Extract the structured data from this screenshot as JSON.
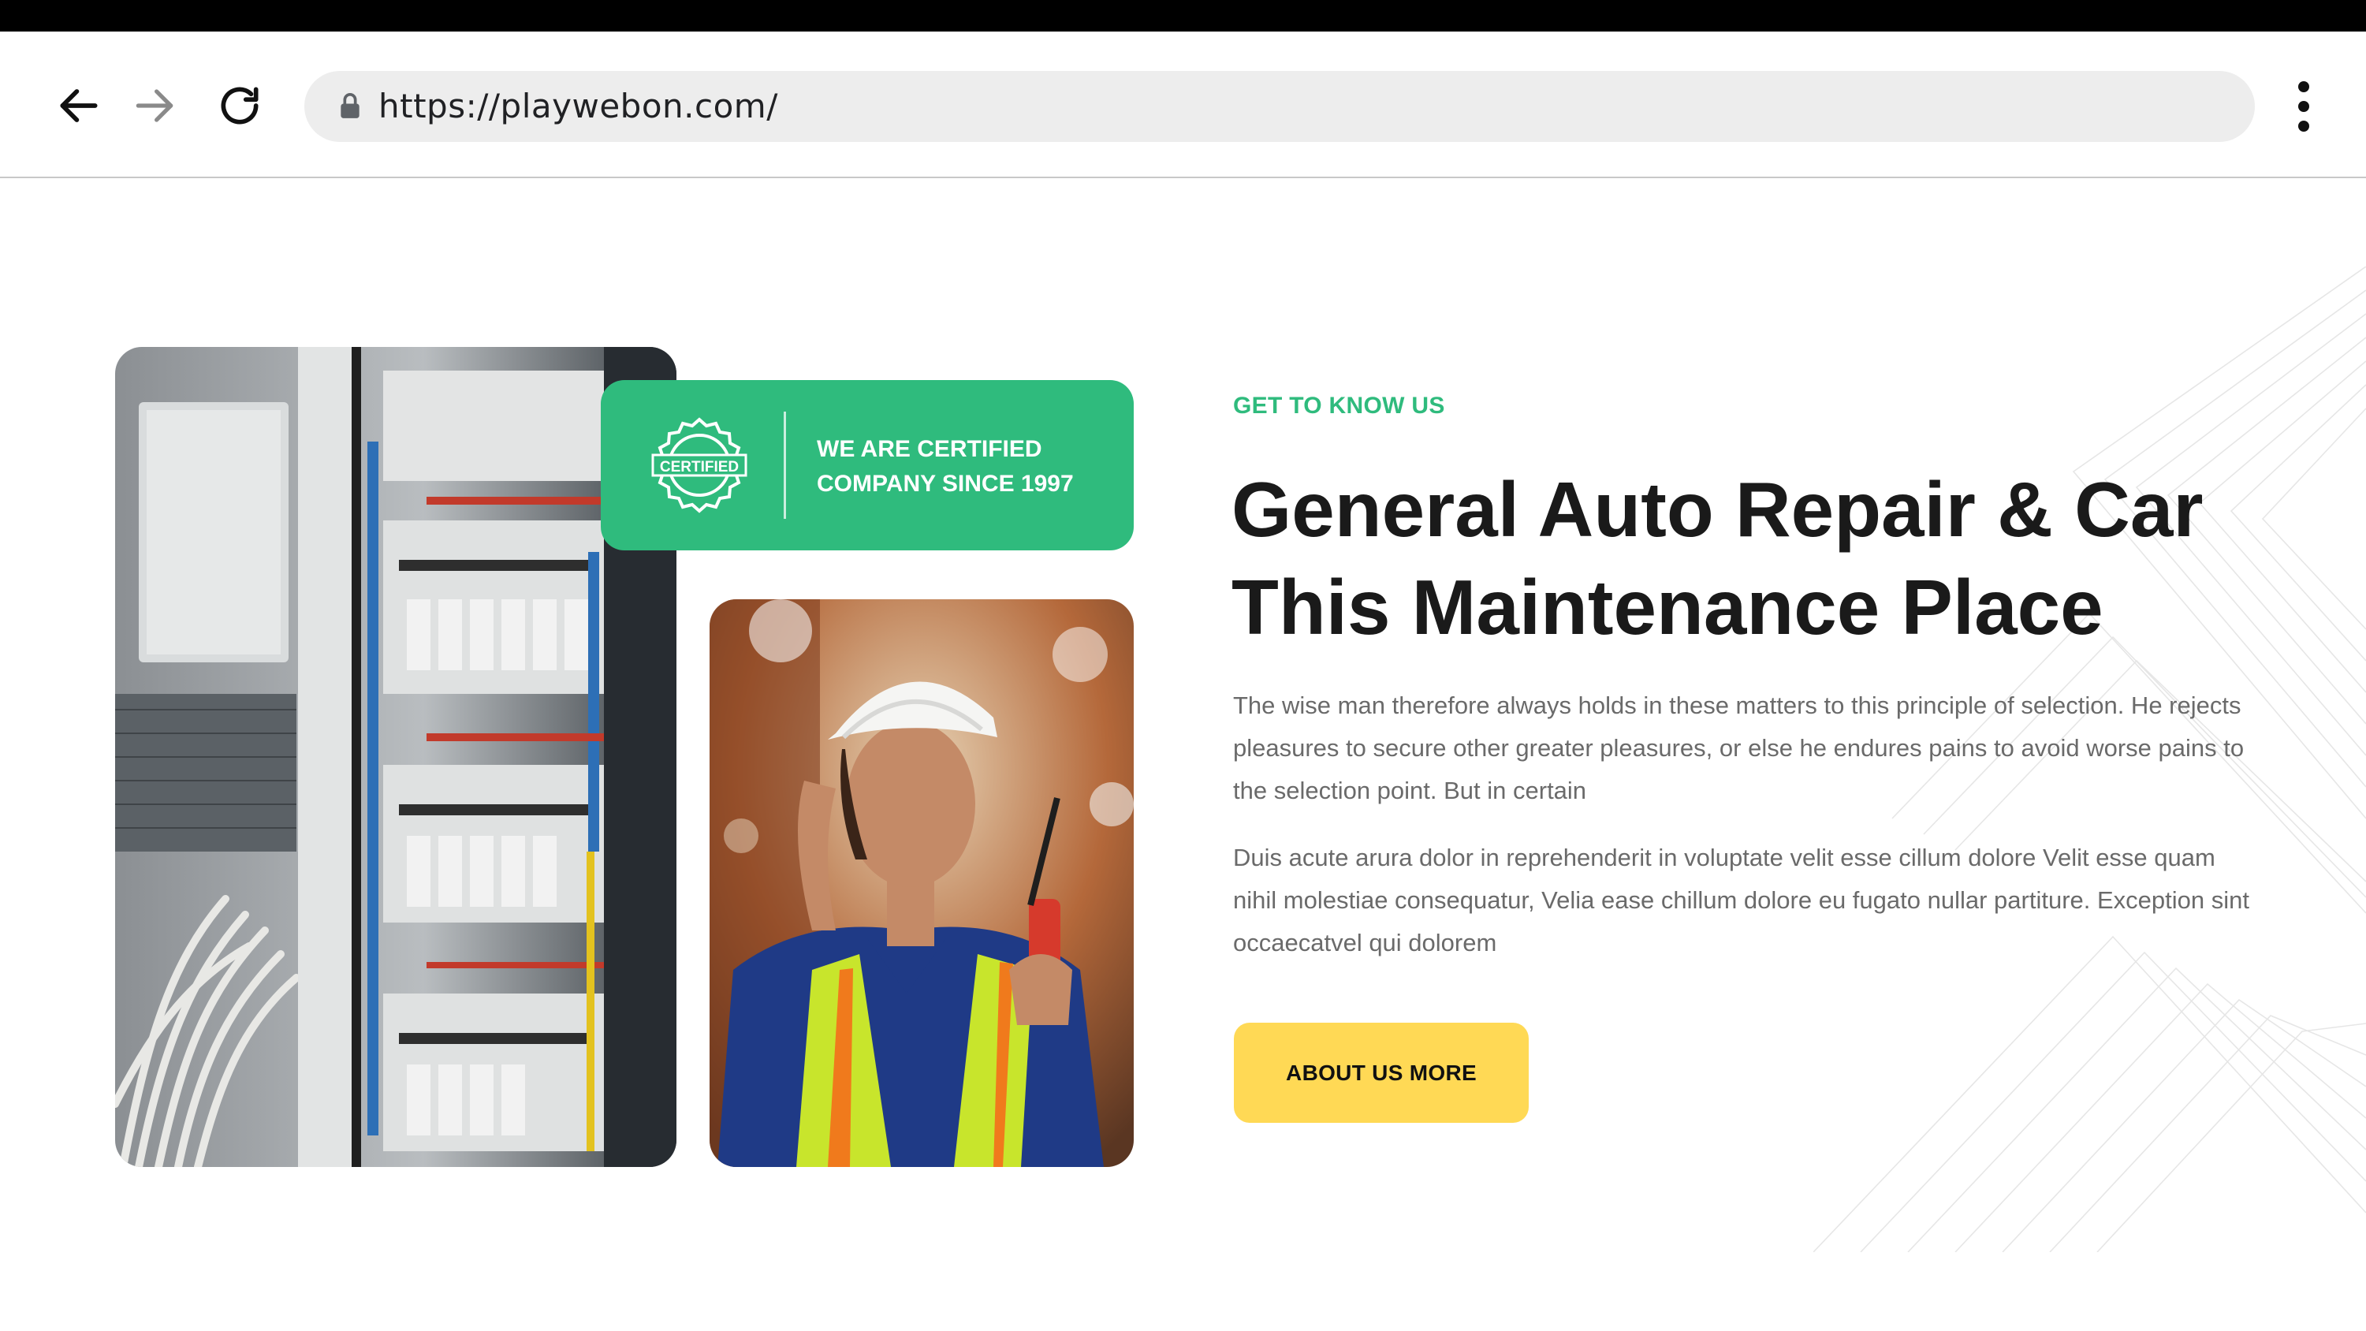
{
  "browser": {
    "url": "https://playwebon.com/",
    "icons": {
      "back": "arrow-left-icon",
      "forward": "arrow-right-icon",
      "reload": "reload-icon",
      "lock": "lock-icon",
      "menu": "more-vertical-icon"
    }
  },
  "badge": {
    "icon_text": "CERTIFIED",
    "line1": "WE ARE CERTIFIED",
    "line2": "COMPANY SINCE 1997"
  },
  "about": {
    "eyebrow": "GET TO KNOW US",
    "heading_line1": "General Auto Repair & Car",
    "heading_line2": "This Maintenance Place",
    "paragraph1": "The wise man therefore always holds in these matters to this principle of selection. He rejects pleasures to secure other greater pleasures, or else he endures pains to avoid worse pains to the selection point. But in certain",
    "paragraph2": "Duis acute arura dolor in reprehenderit in voluptate velit esse cillum dolore Velit esse quam nihil molestiae consequatur, Velia ease chillum dolore eu fugato nullar partiture. Exception sint occaecatvel qui dolorem",
    "button_label": "ABOUT US MORE"
  },
  "colors": {
    "accent_green": "#2fbb7d",
    "button_yellow": "#ffd955",
    "heading": "#1a1a1a",
    "body_text": "#6a6a6a",
    "url_bar": "#ededed"
  }
}
